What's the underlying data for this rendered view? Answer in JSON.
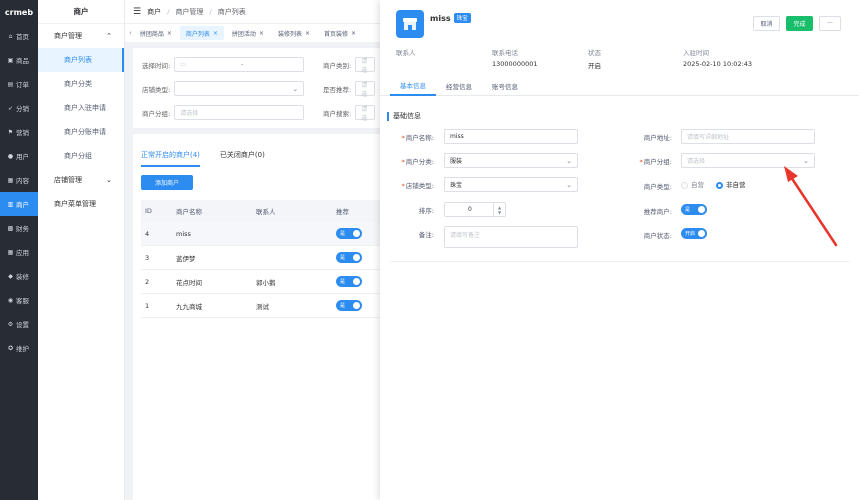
{
  "logo": "crmeb",
  "rail": [
    {
      "icon": "home-icon",
      "glyph": "⌂",
      "label": "首页"
    },
    {
      "icon": "goods-icon",
      "glyph": "▣",
      "label": "商品"
    },
    {
      "icon": "order-icon",
      "glyph": "▤",
      "label": "订单"
    },
    {
      "icon": "distribution-icon",
      "glyph": "➶",
      "label": "分销"
    },
    {
      "icon": "marketing-icon",
      "glyph": "⚑",
      "label": "营销"
    },
    {
      "icon": "user-icon",
      "glyph": "●",
      "label": "用户"
    },
    {
      "icon": "content-icon",
      "glyph": "▦",
      "label": "内容"
    },
    {
      "icon": "merchant-icon",
      "glyph": "▥",
      "label": "商户"
    },
    {
      "icon": "finance-icon",
      "glyph": "▩",
      "label": "财务"
    },
    {
      "icon": "app-icon",
      "glyph": "▦",
      "label": "应用"
    },
    {
      "icon": "decorate-icon",
      "glyph": "◆",
      "label": "装修"
    },
    {
      "icon": "service-icon",
      "glyph": "◉",
      "label": "客服"
    },
    {
      "icon": "settings-icon",
      "glyph": "⚙",
      "label": "设置"
    },
    {
      "icon": "maintain-icon",
      "glyph": "✪",
      "label": "维护"
    }
  ],
  "submenu": {
    "title": "商户",
    "group1": "商户管理",
    "items": [
      "商户列表",
      "商户分类",
      "商户入驻申请",
      "商户分账申请",
      "商户分组"
    ],
    "group2": "店铺管理",
    "group3": "商户菜单管理"
  },
  "breadcrumb": [
    "商户",
    "商户管理",
    "商户列表"
  ],
  "tabs": [
    "拼团商品",
    "商户列表",
    "拼团活动",
    "装修列表",
    "首页装修"
  ],
  "filter": {
    "time_label": "选择时间:",
    "time_sep": "-",
    "category_label": "商户类别:",
    "category_ph": "请选",
    "store_type_label": "店铺类型:",
    "recommend_label": "是否推荐:",
    "recommend_ph": "请选",
    "group_label": "商户分组:",
    "group_ph": "请选择",
    "search_label": "商户搜索:",
    "search_ph": "请选"
  },
  "list": {
    "tab_open": "正常开启的商户(4)",
    "tab_closed": "已关闭商户(0)",
    "add_button": "添加商户",
    "headers": [
      "ID",
      "商户名称",
      "联系人",
      "推荐"
    ],
    "rows": [
      {
        "id": "4",
        "name": "miss",
        "contact": "",
        "rec": "是"
      },
      {
        "id": "3",
        "name": "蓝伊梦",
        "contact": "",
        "rec": "是"
      },
      {
        "id": "2",
        "name": "花点时间",
        "contact": "郭小鹅",
        "rec": "是"
      },
      {
        "id": "1",
        "name": "九九商城",
        "contact": "测试",
        "rec": "是"
      }
    ]
  },
  "drawer": {
    "name": "miss",
    "badge": "珠宝",
    "cancel": "取消",
    "done": "完成",
    "more": "···",
    "meta_labels": [
      "联系人",
      "联系电话",
      "状态",
      "入驻时间"
    ],
    "meta_values": [
      "",
      "13000000001",
      "开启",
      "2025-02-10 10:02:43"
    ],
    "tabs": [
      "基本信息",
      "经营信息",
      "账号信息"
    ],
    "section": "基础信息",
    "form": {
      "name_label": "商户名称:",
      "name_value": "miss",
      "category_label": "商户分类:",
      "category_value": "服装",
      "store_type_label": "店铺类型:",
      "store_type_value": "珠宝",
      "sort_label": "排序:",
      "sort_value": "0",
      "remark_label": "备注:",
      "remark_ph": "请填写备注",
      "address_label": "商户地址:",
      "address_ph": "请填写详细地址",
      "group_label": "商户分组:",
      "group_ph": "请选择",
      "type_label": "商户类型:",
      "type_opt1": "自营",
      "type_opt2": "非自营",
      "recommend_label": "推荐商户:",
      "recommend_value": "是",
      "status_label": "商户状态:",
      "status_value": "开启"
    }
  },
  "colors": {
    "primary": "#2d8cf0",
    "success": "#19be6b",
    "arrow": "#e8352b",
    "rail": "#282c34"
  }
}
